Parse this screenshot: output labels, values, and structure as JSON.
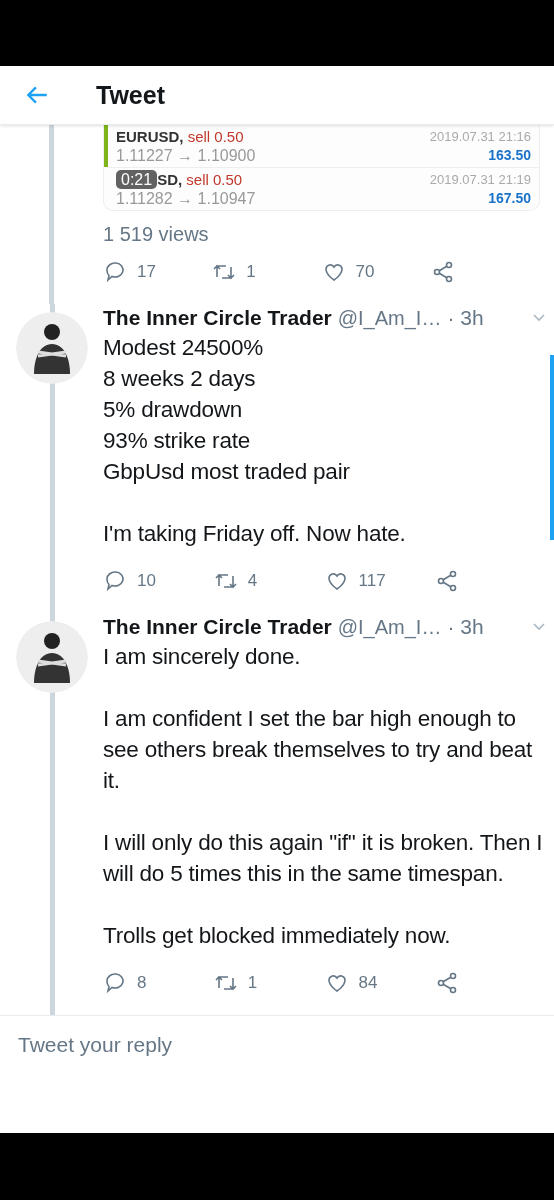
{
  "header": {
    "title": "Tweet"
  },
  "quoted_tweet": {
    "trades": [
      {
        "symbol": "EURUSD,",
        "side": "sell 0.50",
        "prices": "1.11227 → 1.10900",
        "time": "2019.07.31 21:16",
        "profit": "163.50",
        "highlighted": true
      },
      {
        "badge": "0:21",
        "symbol": "SD,",
        "side": "sell 0.50",
        "prices": "1.11282 → 1.10947",
        "time": "2019.07.31 21:19",
        "profit": "167.50",
        "highlighted": false
      }
    ],
    "views": "1 519 views",
    "actions": {
      "replies": "17",
      "retweets": "1",
      "likes": "70"
    }
  },
  "tweets": [
    {
      "name": "The Inner Circle Trader",
      "handle": "@I_Am_I…",
      "time": "· 3h",
      "paragraphs": [
        "Modest 24500%\n8 weeks 2 days\n5% drawdown\n93% strike rate\nGbpUsd most traded pair",
        "I'm taking Friday off. Now hate."
      ],
      "actions": {
        "replies": "10",
        "retweets": "4",
        "likes": "117"
      }
    },
    {
      "name": "The Inner Circle Trader",
      "handle": "@I_Am_I…",
      "time": "· 3h",
      "paragraphs": [
        "I am sincerely done.",
        "I am confident I set the bar high enough to see others break themselves to try and beat it.",
        "I will only do this again \"if\" it is broken. Then I will do 5 times this in the same timespan.",
        "Trolls get blocked immediately now."
      ],
      "actions": {
        "replies": "8",
        "retweets": "1",
        "likes": "84"
      }
    }
  ],
  "reply_field": {
    "placeholder": "Tweet your reply"
  }
}
